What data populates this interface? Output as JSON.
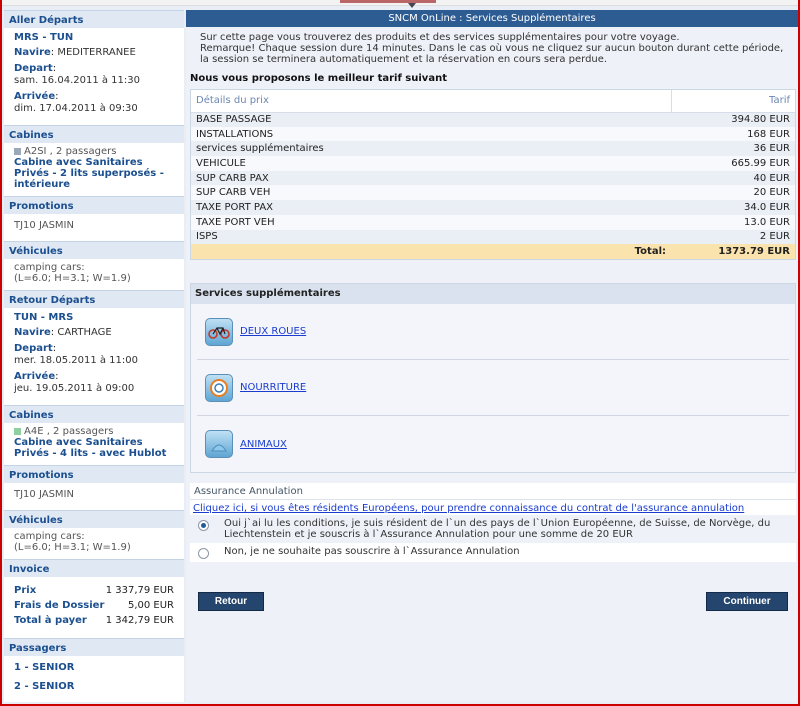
{
  "sidebar": {
    "outbound": {
      "header": "Aller Départs",
      "route": "MRS - TUN",
      "ship_label": "Navire",
      "ship": "MEDITERRANEE",
      "depart_label": "Depart",
      "depart": "sam. 16.04.2011 à 11:30",
      "arrival_label": "Arrivée",
      "arrival": "dim. 17.04.2011 à 09:30"
    },
    "cabins_out": {
      "header": "Cabines",
      "code": "A2SI , 2 passagers",
      "desc": "Cabine avec Sanitaires Privés - 2 lits superposés - intérieure"
    },
    "promo_out": {
      "header": "Promotions",
      "value": "TJ10 JASMIN"
    },
    "vehicles_out": {
      "header": "Véhicules",
      "line1": "camping cars:",
      "line2": "(L=6.0; H=3.1; W=1.9)"
    },
    "return": {
      "header": "Retour Départs",
      "route": "TUN - MRS",
      "ship_label": "Navire",
      "ship": "CARTHAGE",
      "depart_label": "Depart",
      "depart": "mer. 18.05.2011 à 11:00",
      "arrival_label": "Arrivée",
      "arrival": "jeu. 19.05.2011 à 09:00"
    },
    "cabins_ret": {
      "header": "Cabines",
      "code": "A4E , 2 passagers",
      "desc": "Cabine avec Sanitaires Privés - 4 lits - avec Hublot"
    },
    "promo_ret": {
      "header": "Promotions",
      "value": "TJ10 JASMIN"
    },
    "vehicles_ret": {
      "header": "Véhicules",
      "line1": "camping cars:",
      "line2": "(L=6.0; H=3.1; W=1.9)"
    },
    "invoice": {
      "header": "Invoice",
      "rows": [
        {
          "k": "Prix",
          "v": "1 337,79 EUR"
        },
        {
          "k": "Frais de Dossier",
          "v": "5,00 EUR"
        },
        {
          "k": "Total à payer",
          "v": "1 342,79 EUR"
        }
      ]
    },
    "passengers": {
      "header": "Passagers",
      "items": [
        "1 - SENIOR",
        "2 - SENIOR"
      ]
    }
  },
  "main": {
    "title": "SNCM OnLine : Services Supplémentaires",
    "intro_line1": "Sur cette page vous trouverez des produits et des services supplémentaires pour votre voyage.",
    "intro_line2": "Remarque! Chaque session dure 14 minutes. Dans le cas où vous ne cliquez sur aucun bouton durant cette période, la session se terminera automatiquement et la réservation en cours sera perdue.",
    "best_offer": "Nous vous proposons le meilleur tarif suivant",
    "price_table": {
      "col_details": "Détails du prix",
      "col_tarif": "Tarif",
      "rows": [
        {
          "label": "BASE PASSAGE",
          "value": "394.80 EUR"
        },
        {
          "label": "INSTALLATIONS",
          "value": "168 EUR"
        },
        {
          "label": "services supplémentaires",
          "value": "36 EUR"
        },
        {
          "label": "VEHICULE",
          "value": "665.99 EUR"
        },
        {
          "label": "SUP CARB PAX",
          "value": "40 EUR"
        },
        {
          "label": "SUP CARB VEH",
          "value": "20 EUR"
        },
        {
          "label": "TAXE PORT PAX",
          "value": "34.0 EUR"
        },
        {
          "label": "TAXE PORT VEH",
          "value": "13.0 EUR"
        },
        {
          "label": "ISPS",
          "value": "2 EUR"
        }
      ],
      "total_label": "Total:",
      "total_value": "1373.79 EUR"
    },
    "services": {
      "header": "Services supplémentaires",
      "items": [
        {
          "label": "DEUX ROUES",
          "icon": "bicycle-icon"
        },
        {
          "label": "NOURRITURE",
          "icon": "food-plate-icon"
        },
        {
          "label": "ANIMAUX",
          "icon": "animal-icon"
        }
      ]
    },
    "insurance": {
      "header": "Assurance Annulation",
      "link": "Cliquez ici, si vous êtes résidents Européens, pour prendre connaissance du contrat de l'assurance annulation",
      "option_yes": "Oui j`ai lu les conditions, je suis résident de l`un des pays de l`Union Européenne, de Suisse, de Norvège, du Liechtenstein et je souscris à l`Assurance Annulation pour une somme de  20 EUR",
      "option_no": "Non, je ne souhaite pas souscrire à l`Assurance Annulation"
    },
    "buttons": {
      "back": "Retour",
      "next": "Continuer"
    }
  }
}
